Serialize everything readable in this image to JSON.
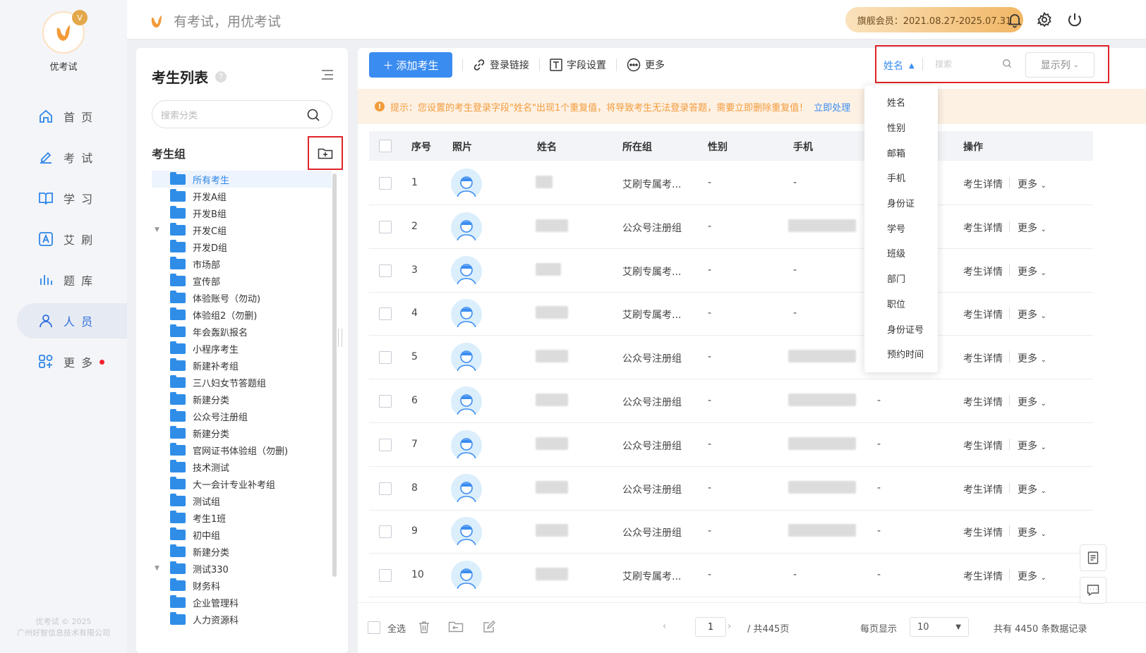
{
  "app": {
    "name": "优考试",
    "badge": "V",
    "copyright_line1": "优考试 © 2025",
    "copyright_line2": "广州好智信息技术有限公司"
  },
  "nav": [
    {
      "label": "首 页",
      "icon": "home-icon"
    },
    {
      "label": "考 试",
      "icon": "exam-icon"
    },
    {
      "label": "学 习",
      "icon": "book-icon"
    },
    {
      "label": "艾 刷",
      "icon": "a-icon"
    },
    {
      "label": "题 库",
      "icon": "chart-bars-icon"
    },
    {
      "label": "人 员",
      "icon": "user-icon",
      "active": true
    },
    {
      "label": "更 多",
      "icon": "grid-icon",
      "dot": true
    }
  ],
  "topbar": {
    "slogan": "有考试，用优考试",
    "member": "旗舰会员：2021.08.27-2025.07.31"
  },
  "left": {
    "title": "考生列表",
    "help": "?",
    "search_placeholder": "搜索分类",
    "group_label": "考生组",
    "groups": [
      {
        "label": "所有考生",
        "selected": true,
        "arrow": ""
      },
      {
        "label": "开发A组",
        "arrow": ""
      },
      {
        "label": "开发B组",
        "arrow": ""
      },
      {
        "label": "开发C组",
        "arrow": "▼"
      },
      {
        "label": "开发D组",
        "arrow": ""
      },
      {
        "label": "市场部",
        "arrow": ""
      },
      {
        "label": "宣传部",
        "arrow": ""
      },
      {
        "label": "体验账号（勿动)",
        "arrow": ""
      },
      {
        "label": "体验组2（勿删)",
        "arrow": ""
      },
      {
        "label": "年会轰趴报名",
        "arrow": ""
      },
      {
        "label": "小程序考生",
        "arrow": ""
      },
      {
        "label": "新建补考组",
        "arrow": ""
      },
      {
        "label": "三八妇女节答题组",
        "arrow": ""
      },
      {
        "label": "新建分类",
        "arrow": ""
      },
      {
        "label": "公众号注册组",
        "arrow": ""
      },
      {
        "label": "新建分类",
        "arrow": ""
      },
      {
        "label": "官网证书体验组（勿删)",
        "arrow": ""
      },
      {
        "label": "技术测试",
        "arrow": ""
      },
      {
        "label": "大一会计专业补考组",
        "arrow": ""
      },
      {
        "label": "测试组",
        "arrow": ""
      },
      {
        "label": "考生1班",
        "arrow": ""
      },
      {
        "label": "初中组",
        "arrow": ""
      },
      {
        "label": "新建分类",
        "arrow": ""
      },
      {
        "label": "测试330",
        "arrow": "▼"
      },
      {
        "label": "财务科",
        "arrow": ""
      },
      {
        "label": "企业管理科",
        "arrow": ""
      },
      {
        "label": "人力资源科",
        "arrow": ""
      }
    ]
  },
  "toolbar": {
    "add": "添加考生",
    "login_link": "登录链接",
    "field_settings": "字段设置",
    "more": "更多",
    "field_select": "姓名",
    "search_placeholder": "搜索",
    "show_cols": "显示列"
  },
  "warning": {
    "icon": "!",
    "text": "提示：您设置的考生登录字段\"姓名\"出现1个重复值，将导致考生无法登录答题，需要立即删除重复值！",
    "action": "立即处理"
  },
  "table": {
    "headers": [
      "序号",
      "照片",
      "姓名",
      "所在组",
      "性别",
      "手机",
      "操作"
    ],
    "rows": [
      {
        "no": "1",
        "group": "艾刷专属考...",
        "gender": "-",
        "phone": "-",
        "extra": "",
        "detail": "考生详情",
        "more": "更多"
      },
      {
        "no": "2",
        "group": "公众号注册组",
        "gender": "-",
        "phone": "",
        "extra": "",
        "detail": "考生详情",
        "more": "更多"
      },
      {
        "no": "3",
        "group": "艾刷专属考...",
        "gender": "-",
        "phone": "-",
        "extra": "",
        "detail": "考生详情",
        "more": "更多"
      },
      {
        "no": "4",
        "group": "艾刷专属考...",
        "gender": "-",
        "phone": "-",
        "extra": "",
        "detail": "考生详情",
        "more": "更多"
      },
      {
        "no": "5",
        "group": "公众号注册组",
        "gender": "-",
        "phone": "",
        "extra": "",
        "detail": "考生详情",
        "more": "更多"
      },
      {
        "no": "6",
        "group": "公众号注册组",
        "gender": "-",
        "phone": "",
        "extra": "-",
        "detail": "考生详情",
        "more": "更多"
      },
      {
        "no": "7",
        "group": "公众号注册组",
        "gender": "-",
        "phone": "",
        "extra": "-",
        "detail": "考生详情",
        "more": "更多"
      },
      {
        "no": "8",
        "group": "公众号注册组",
        "gender": "-",
        "phone": "",
        "extra": "-",
        "detail": "考生详情",
        "more": "更多"
      },
      {
        "no": "9",
        "group": "公众号注册组",
        "gender": "-",
        "phone": "",
        "extra": "-",
        "detail": "考生详情",
        "more": "更多"
      },
      {
        "no": "10",
        "group": "艾刷专属考...",
        "gender": "-",
        "phone": "-",
        "extra": "-",
        "detail": "考生详情",
        "more": "更多"
      }
    ]
  },
  "dropdown": [
    "姓名",
    "性别",
    "邮箱",
    "手机",
    "身份证",
    "学号",
    "班级",
    "部门",
    "职位",
    "身份证号",
    "预约时间"
  ],
  "footer": {
    "select_all": "全选",
    "page": "1",
    "total_pages": "/ 共445页",
    "per_page_label": "每页显示",
    "per_page": "10",
    "total": "共有 4450 条数据记录"
  }
}
